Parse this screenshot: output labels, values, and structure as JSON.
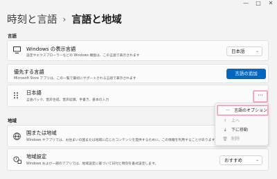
{
  "window": {
    "minimize_glyph": "—",
    "maximize_glyph": "□",
    "close_glyph": "✕"
  },
  "header": {
    "parent": "時刻と言語",
    "separator": "›",
    "current": "言語と地域"
  },
  "language_section": {
    "label": "言語",
    "display_language": {
      "title": "Windows の表示言語",
      "description": "設定やエクスプローラーなどの Windows 機能は、この言語で表示されます",
      "value": "日本語"
    },
    "preferred": {
      "title": "優先する言語",
      "description": "Microsoft Store アプリは、この一覧で最初にサポートされる言語で表示されます",
      "add_button": "言語の追加"
    },
    "installed_language": {
      "title": "日本語",
      "description": "言語パック、音声合成、音声認識、手書き、基本の入力",
      "more_glyph": "···"
    },
    "menu": {
      "options": "言語のオプション",
      "move_up": "上へ",
      "move_down": "下に移動",
      "remove": "削除"
    }
  },
  "region_section": {
    "label": "地域",
    "country": {
      "title": "国または地域",
      "description": "Windows やアプリでは、お住まいの国または地域に応じたコンテンツを提供するために、この情報を利用することがあります"
    },
    "regional_format": {
      "title": "地域設定",
      "description": "Windows および一部のアプリでは、地域設定に基づいて日付と時刻を書式設定します。",
      "value": "おすすめ"
    }
  },
  "icons": {
    "display": "monitor-icon",
    "preferred": "drag-icon",
    "globe": "globe-icon",
    "format": "regional-format-icon"
  }
}
